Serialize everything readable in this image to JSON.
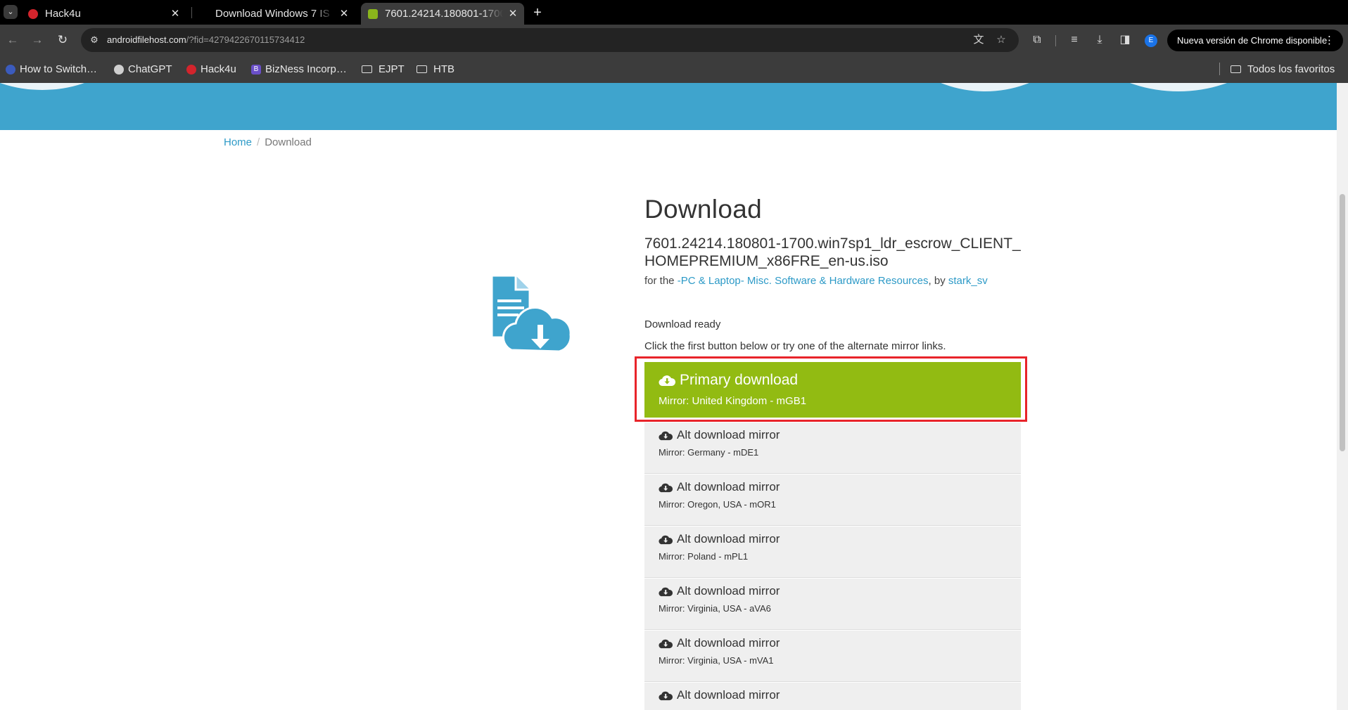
{
  "browser": {
    "tabs": [
      {
        "title": "Hack4u",
        "favicon_color": "#d3242c",
        "active": false
      },
      {
        "title": "Download Windows 7 IS",
        "favicon_color": "",
        "active": false
      },
      {
        "title": "7601.24214.180801-1700",
        "favicon_color": "#8ab51c",
        "active": true
      }
    ],
    "url_host": "androidfilehost.com",
    "url_path": "/?fid=4279422670115734412",
    "update_label": "Nueva versión de Chrome disponible",
    "profile_initial": "E",
    "bookmarks": [
      {
        "label": "How to Switch…",
        "icon": "globe-icon"
      },
      {
        "label": "ChatGPT",
        "icon": "chatgpt-icon"
      },
      {
        "label": "Hack4u",
        "icon": "hack4u-icon"
      },
      {
        "label": "BizNess Incorp…",
        "icon": "b-icon"
      },
      {
        "label": "EJPT",
        "icon": "folder-icon"
      },
      {
        "label": "HTB",
        "icon": "folder-icon"
      }
    ],
    "all_bookmarks_label": "Todos los favoritos"
  },
  "page": {
    "breadcrumb": {
      "home": "Home",
      "current": "Download"
    },
    "title": "Download",
    "file_name": "7601.24214.180801-1700.win7sp1_ldr_escrow_CLIENT_HOMEPREMIUM_x86FRE_en-us.iso",
    "for_prefix": "for the",
    "category_link": "-PC & Laptop- Misc. Software & Hardware Resources",
    "by_prefix": ", by",
    "author_link": "stark_sv",
    "status": "Download ready",
    "hint": "Click the first button below or try one of the alternate mirror links.",
    "primary": {
      "label": "Primary download",
      "mirror": "Mirror: United Kingdom - mGB1"
    },
    "alt_label": "Alt download mirror",
    "alternates": [
      {
        "label": "Alt download mirror",
        "mirror": "Mirror: Germany - mDE1"
      },
      {
        "label": "Alt download mirror",
        "mirror": "Mirror: Oregon, USA - mOR1"
      },
      {
        "label": "Alt download mirror",
        "mirror": "Mirror: Poland - mPL1"
      },
      {
        "label": "Alt download mirror",
        "mirror": "Mirror: Virginia, USA - aVA6"
      },
      {
        "label": "Alt download mirror",
        "mirror": "Mirror: Virginia, USA - mVA1"
      },
      {
        "label": "Alt download mirror",
        "mirror": ""
      }
    ]
  },
  "colors": {
    "banner": "#3fa4cd",
    "link": "#2d9ac7",
    "primary_button": "#92bb12",
    "highlight_outline": "#e8242a",
    "alt_button": "#efefef"
  }
}
